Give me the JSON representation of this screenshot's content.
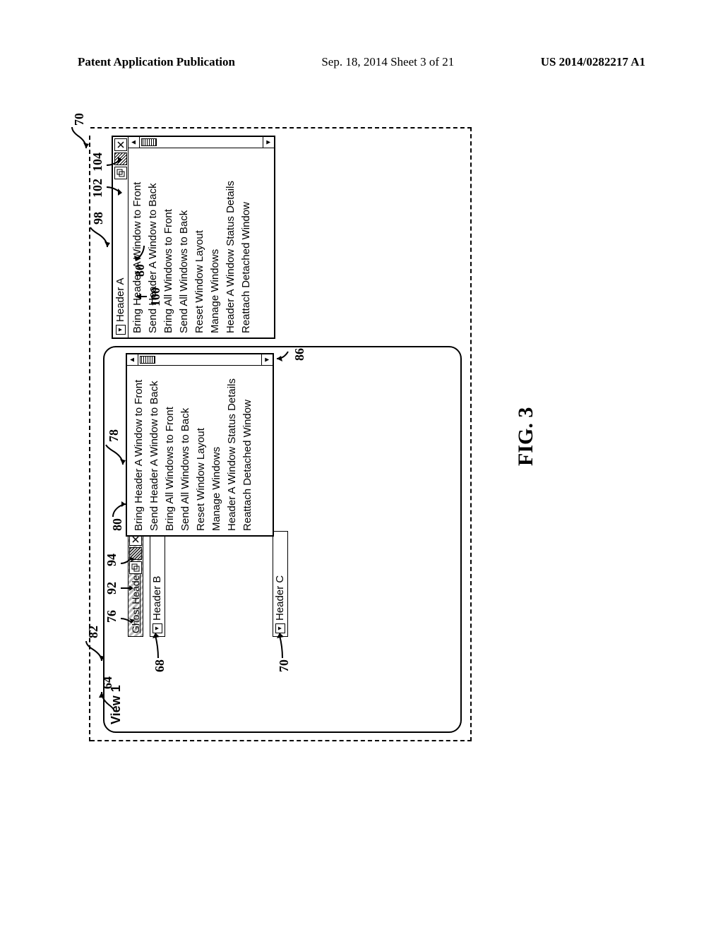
{
  "header": {
    "left": "Patent Application Publication",
    "center": "Sep. 18, 2014  Sheet 3 of 21",
    "right": "US 2014/0282217 A1"
  },
  "figure_label": "FIG. 3",
  "main_window": {
    "title": "View 1",
    "ghost_header": "Ghost Header A",
    "header_b": "Header B",
    "header_c": "Header C"
  },
  "detached": {
    "title": "Header A",
    "menu": {
      "bring_a_front": "Bring Header A Window to Front",
      "send_a_back": "Send Header A Window to Back",
      "bring_all_front": "Bring All Windows to Front",
      "send_all_back": "Send All Windows to Back",
      "reset_layout": "Reset Window Layout",
      "manage": "Manage Windows",
      "status_details": "Header A Window Status Details",
      "reattach": "Reattach Detached Window"
    }
  },
  "refs": {
    "r70": "70",
    "r82": "82",
    "r64": "64",
    "r76": "76",
    "r92": "92",
    "r94": "94",
    "r80a": "80",
    "r68": "68",
    "r70b": "70",
    "r78": "78",
    "r86": "86",
    "r100": "100",
    "r102": "102",
    "r104": "104",
    "r80b": "80",
    "r98": "98"
  }
}
